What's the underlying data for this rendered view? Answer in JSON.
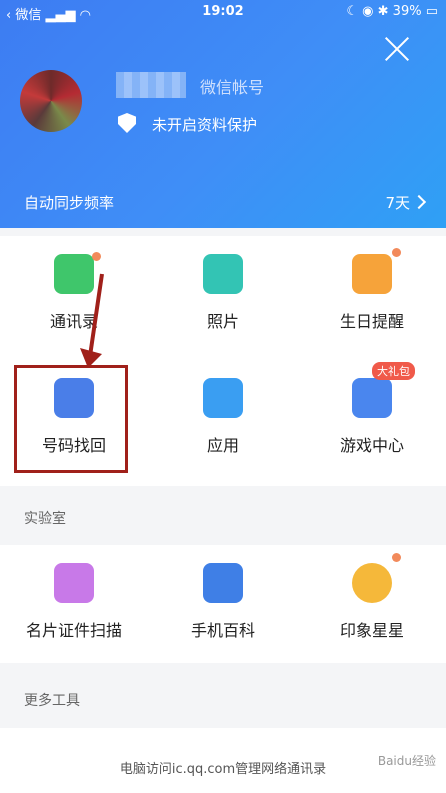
{
  "status_bar": {
    "back_label": "微信",
    "time": "19:02",
    "battery": "39%"
  },
  "profile": {
    "account_label": "微信帐号",
    "protection_text": "未开启资料保护"
  },
  "sync": {
    "label": "自动同步频率",
    "value": "7天"
  },
  "main_grid": [
    {
      "label": "通讯录",
      "icon": "contacts-icon"
    },
    {
      "label": "照片",
      "icon": "photos-icon"
    },
    {
      "label": "生日提醒",
      "icon": "birthday-cake-icon"
    },
    {
      "label": "号码找回",
      "icon": "number-recovery-icon"
    },
    {
      "label": "应用",
      "icon": "apps-icon"
    },
    {
      "label": "游戏中心",
      "icon": "gamepad-icon",
      "badge": "大礼包"
    }
  ],
  "lab": {
    "title": "实验室",
    "items": [
      {
        "label": "名片证件扫描",
        "icon": "card-scan-icon"
      },
      {
        "label": "手机百科",
        "icon": "phone-encyclopedia-icon"
      },
      {
        "label": "印象星星",
        "icon": "impression-star-icon"
      }
    ]
  },
  "more_tools": {
    "title": "更多工具"
  },
  "footer_text": "电脑访问ic.qq.com管理网络通讯录",
  "watermark_text": "Baidu经验",
  "colors": {
    "header_blue": "#3f8ef7",
    "annotation_red": "#a0201a",
    "notification_dot": "#f28a5b"
  }
}
